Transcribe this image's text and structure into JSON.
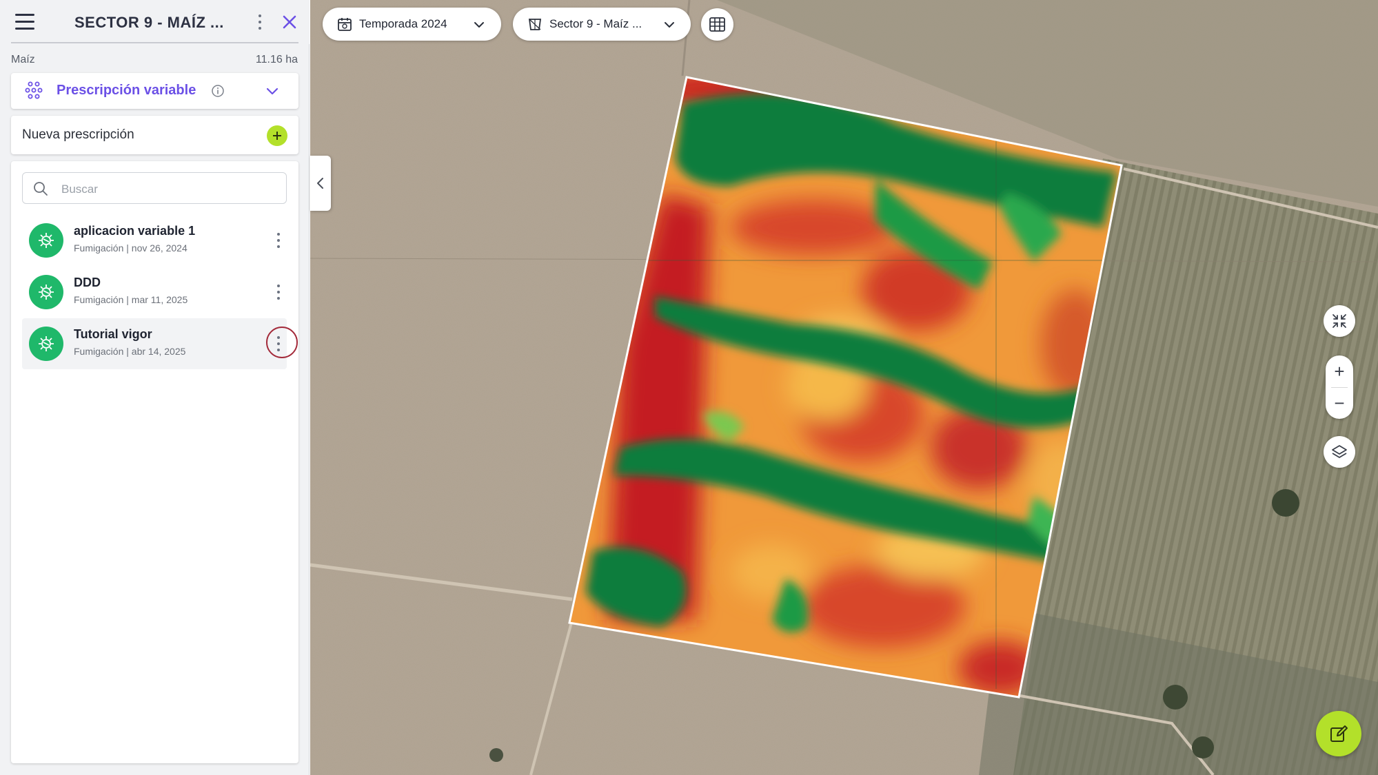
{
  "sidebar": {
    "title": "SECTOR 9 - MAÍZ ...",
    "crop": "Maíz",
    "area": "11.16 ha",
    "mode": {
      "label": "Prescripción variable",
      "icon": "prescription-dots-icon"
    },
    "new_prescription_label": "Nueva prescripción",
    "search_placeholder": "Buscar",
    "items": [
      {
        "name": "aplicacion variable 1",
        "meta": "Fumigación | nov 26, 2024",
        "icon": "fumigation-icon"
      },
      {
        "name": "DDD",
        "meta": "Fumigación | mar 11, 2025",
        "icon": "fumigation-icon"
      },
      {
        "name": "Tutorial vigor",
        "meta": "Fumigación | abr 14, 2025",
        "icon": "fumigation-icon",
        "selected": true
      }
    ]
  },
  "toolbar": {
    "season_label": "Temporada 2024",
    "field_label": "Sector 9 - Maíz ..."
  },
  "colors": {
    "accent_purple": "#6b50e6",
    "fab_green": "#b3e02a",
    "item_icon_green": "#1fb86a",
    "vigor_high": "#0a7d3c",
    "vigor_mid": "#f5b13c",
    "vigor_low": "#c41e22"
  }
}
